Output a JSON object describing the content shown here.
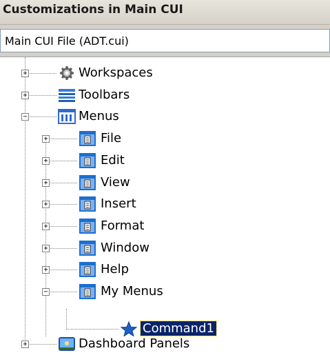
{
  "panel": {
    "title": "Customizations in Main CUI"
  },
  "cui_file_select": {
    "value": "Main CUI File (ADT.cui)"
  },
  "tree": {
    "workspaces": {
      "label": "Workspaces",
      "expander": "+",
      "icon": "gear-icon"
    },
    "toolbars": {
      "label": "Toolbars",
      "expander": "+",
      "icon": "toolbar-icon"
    },
    "menus": {
      "label": "Menus",
      "expander": "−",
      "icon": "menu-group-icon",
      "children": [
        {
          "label": "File",
          "expander": "+"
        },
        {
          "label": "Edit",
          "expander": "+"
        },
        {
          "label": "View",
          "expander": "+"
        },
        {
          "label": "Insert",
          "expander": "+"
        },
        {
          "label": "Format",
          "expander": "+"
        },
        {
          "label": "Window",
          "expander": "+"
        },
        {
          "label": "Help",
          "expander": "+"
        },
        {
          "label": "My Menus",
          "expander": "−",
          "children": [
            {
              "label": "Command1",
              "icon": "star-icon",
              "selected": true
            }
          ]
        }
      ]
    },
    "dashboard_panels": {
      "label": "Dashboard Panels",
      "expander": "+",
      "icon": "dashboard-icon"
    }
  },
  "colors": {
    "selection_bg": "#0a246a",
    "menu_icon_blue": "#1b6fd1",
    "star_blue": "#1e5fc9"
  }
}
